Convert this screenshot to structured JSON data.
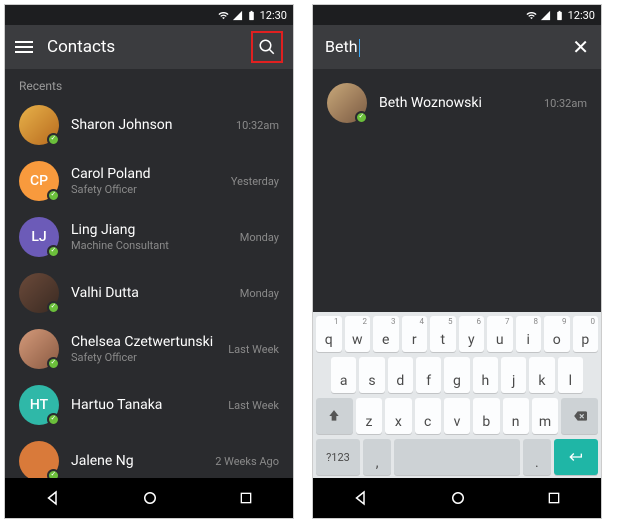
{
  "statusbar": {
    "time": "12:30"
  },
  "left": {
    "title": "Contacts",
    "section": "Recents",
    "rows": [
      {
        "name": "Sharon Johnson",
        "subtitle": "",
        "time": "10:32am",
        "avatar_type": "photo",
        "avatar_bg": "linear-gradient(135deg,#e8b24a,#b76a1e)"
      },
      {
        "name": "Carol Poland",
        "subtitle": "Safety Officer",
        "time": "Yesterday",
        "avatar_type": "initials",
        "initials": "CP",
        "avatar_bg": "#f89a3d"
      },
      {
        "name": "Ling Jiang",
        "subtitle": "Machine Consultant",
        "time": "Monday",
        "avatar_type": "initials",
        "initials": "LJ",
        "avatar_bg": "#6c5bb8"
      },
      {
        "name": "Valhi Dutta",
        "subtitle": "",
        "time": "Monday",
        "avatar_type": "photo",
        "avatar_bg": "linear-gradient(135deg,#6b4a3a,#3a2a22)"
      },
      {
        "name": "Chelsea Czetwertunski",
        "subtitle": "Safety Officer",
        "time": "Last Week",
        "avatar_type": "photo",
        "avatar_bg": "linear-gradient(135deg,#d49a7a,#8a5a42)"
      },
      {
        "name": "Hartuo Tanaka",
        "subtitle": "",
        "time": "Last Week",
        "avatar_type": "initials",
        "initials": "HT",
        "avatar_bg": "#2fb8a8"
      },
      {
        "name": "Jalene Ng",
        "subtitle": "",
        "time": "2 Weeks Ago",
        "avatar_type": "photo",
        "avatar_bg": "#d97a3a"
      }
    ]
  },
  "right": {
    "search_value": "Beth",
    "results": [
      {
        "name": "Beth Woznowski",
        "time": "10:32am",
        "avatar_bg": "linear-gradient(135deg,#c9a87a,#7a5a42)"
      }
    ],
    "keyboard": {
      "row1": [
        "q",
        "w",
        "e",
        "r",
        "t",
        "y",
        "u",
        "i",
        "o",
        "p"
      ],
      "row1_sup": [
        "1",
        "2",
        "3",
        "4",
        "5",
        "6",
        "7",
        "8",
        "9",
        "0"
      ],
      "row2": [
        "a",
        "s",
        "d",
        "f",
        "g",
        "h",
        "j",
        "k",
        "l"
      ],
      "row3": [
        "z",
        "x",
        "c",
        "v",
        "b",
        "n",
        "m"
      ],
      "mode_key": "?123",
      "comma": ",",
      "period": "."
    }
  }
}
